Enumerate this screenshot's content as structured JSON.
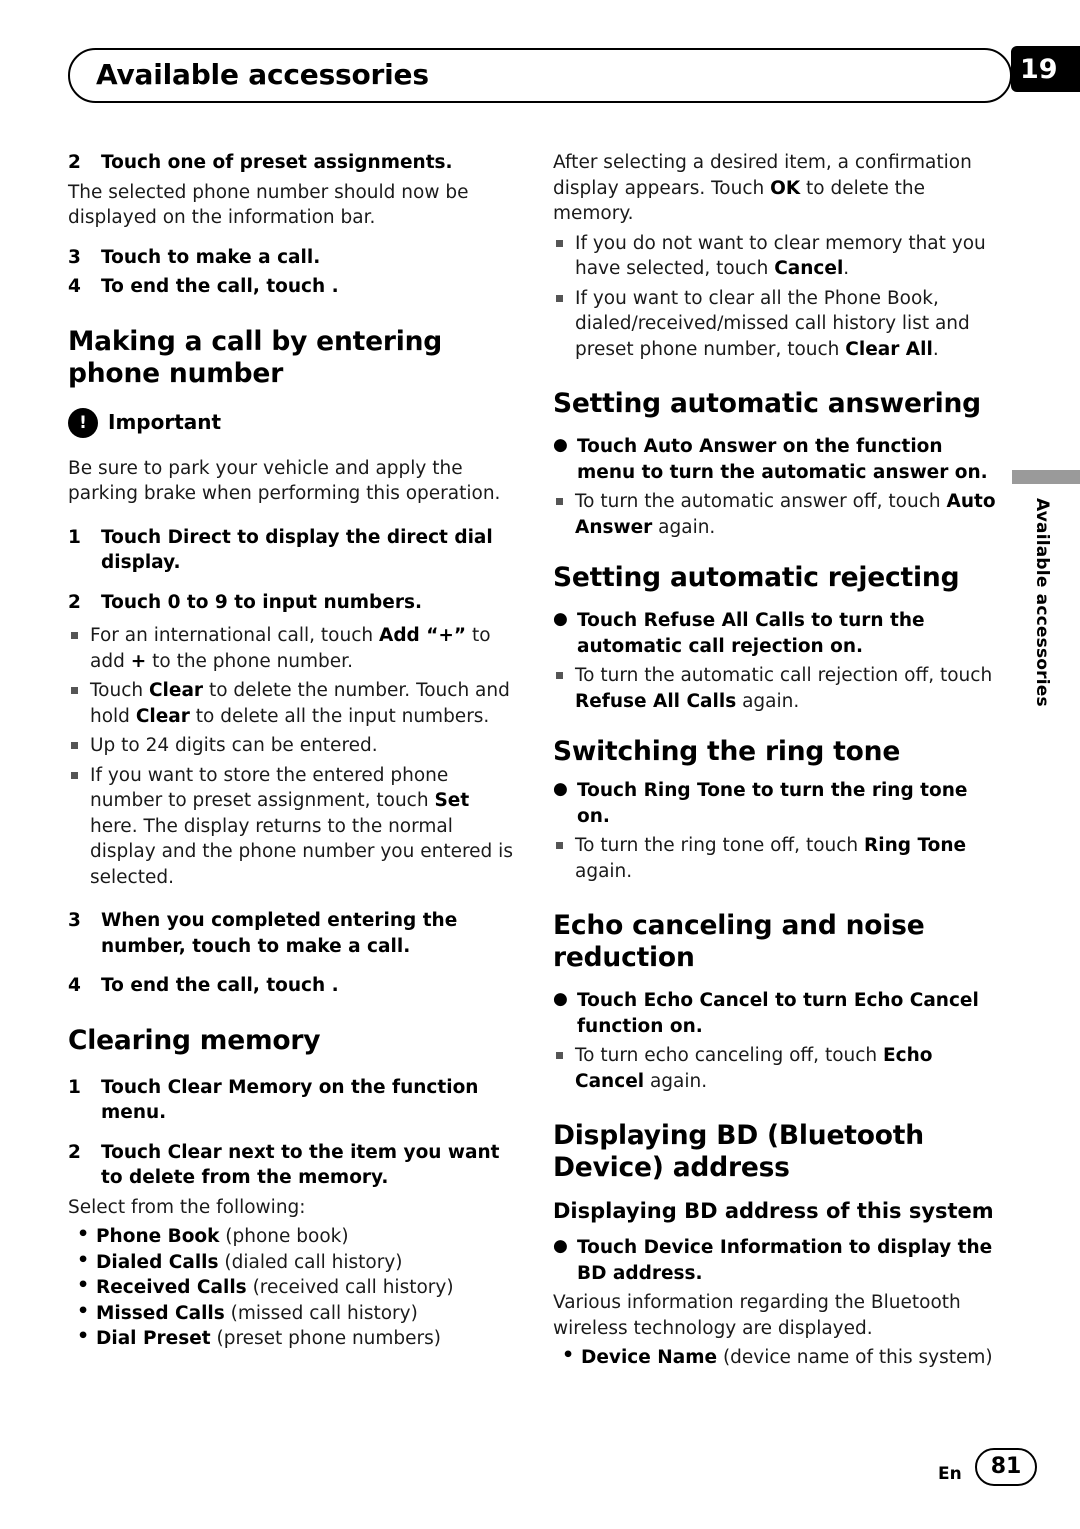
{
  "header": {
    "title": "Available accessories",
    "chapter_number": "19"
  },
  "side_tab": {
    "label": "Available accessories"
  },
  "left_column": {
    "step2_preset": {
      "num": "2",
      "text": "Touch one of preset assignments."
    },
    "preset_body": "The selected phone number should now be displayed on the information bar.",
    "step3_call": {
      "num": "3",
      "text": "Touch    to make a call."
    },
    "step4_end": {
      "num": "4",
      "text": "To end the call, touch    ."
    },
    "heading_making_call": "Making a call by entering phone number",
    "important_label": "Important",
    "important_icon": "!",
    "important_body": "Be sure to park your vehicle and apply the parking brake when performing this operation.",
    "step1_direct": {
      "num": "1",
      "text": "Touch Direct to display the direct dial display."
    },
    "step2_input": {
      "num": "2",
      "text": "Touch 0 to 9 to input numbers."
    },
    "note_intl_a": "For an international call, touch ",
    "note_intl_b": "Add “+”",
    "note_intl_c": " to add ",
    "note_intl_d": "+",
    "note_intl_e": " to the phone number.",
    "note_clear_a": "Touch ",
    "note_clear_b": "Clear",
    "note_clear_c": " to delete the number. Touch and hold ",
    "note_clear_d": "Clear",
    "note_clear_e": " to delete all the input numbers.",
    "note_digits": "Up to 24 digits can be entered.",
    "note_store_a": "If you want to store the entered phone number to preset assignment, touch ",
    "note_store_b": "Set",
    "note_store_c": " here. The display returns to the normal display and the phone number you entered is selected.",
    "step3_completed": {
      "num": "3",
      "text": "When you completed entering the number, touch    to make a call."
    },
    "step4_end2": {
      "num": "4",
      "text": "To end the call, touch    ."
    },
    "heading_clearing_memory": "Clearing memory",
    "step1_clear_memory": {
      "num": "1",
      "text": "Touch Clear Memory on the function menu."
    },
    "step2_clear_next": {
      "num": "2",
      "text": "Touch Clear next to the item you want to delete from the memory."
    },
    "select_following": "Select from the following:",
    "items": [
      {
        "bold": "Phone Book",
        "normal": " (phone book)"
      },
      {
        "bold": "Dialed Calls",
        "normal": " (dialed call history)"
      },
      {
        "bold": "Received Calls",
        "normal": " (received call history)"
      },
      {
        "bold": "Missed Calls",
        "normal": " (missed call history)"
      },
      {
        "bold": "Dial Preset",
        "normal": " (preset phone numbers)"
      }
    ]
  },
  "right_column": {
    "confirm_a": "After selecting a desired item, a confirmation display appears. Touch ",
    "confirm_b": "OK",
    "confirm_c": " to delete the memory.",
    "note_noclear_a": "If you do not want to clear memory that you have selected, touch ",
    "note_noclear_b": "Cancel",
    "note_noclear_c": ".",
    "note_clearall_a": "If you want to clear all the Phone Book, dialed/received/missed call history list and preset phone number, touch ",
    "note_clearall_b": "Clear All",
    "note_clearall_c": ".",
    "heading_auto_answer": "Setting automatic answering",
    "bullet_auto_answer": "Touch Auto Answer on the function menu to turn the automatic answer on.",
    "note_auto_answer_a": "To turn the automatic answer off, touch ",
    "note_auto_answer_b": "Auto Answer",
    "note_auto_answer_c": " again.",
    "heading_auto_reject": "Setting automatic rejecting",
    "bullet_auto_reject": "Touch Refuse All Calls to turn the automatic call rejection on.",
    "note_auto_reject_a": "To turn the automatic call rejection off, touch ",
    "note_auto_reject_b": "Refuse All Calls",
    "note_auto_reject_c": " again.",
    "heading_ring_tone": "Switching the ring tone",
    "bullet_ring_tone": "Touch Ring Tone to turn the ring tone on.",
    "note_ring_tone_a": "To turn the ring tone off, touch ",
    "note_ring_tone_b": "Ring Tone",
    "note_ring_tone_c": " again.",
    "heading_echo": "Echo canceling and noise reduction",
    "bullet_echo": "Touch Echo Cancel to turn Echo Cancel function on.",
    "note_echo_a": "To turn echo canceling off, touch ",
    "note_echo_b": "Echo Cancel",
    "note_echo_c": " again.",
    "heading_bd": "Displaying BD (Bluetooth Device) address",
    "subheading_bd": "Displaying BD address of this system",
    "bullet_bd": "Touch Device Information to display the BD address.",
    "bd_body": "Various information regarding the Bluetooth wireless technology are displayed.",
    "bd_item_bold": "Device Name",
    "bd_item_normal": " (device name of this system)"
  },
  "footer": {
    "lang": "En",
    "page_number": "81"
  }
}
